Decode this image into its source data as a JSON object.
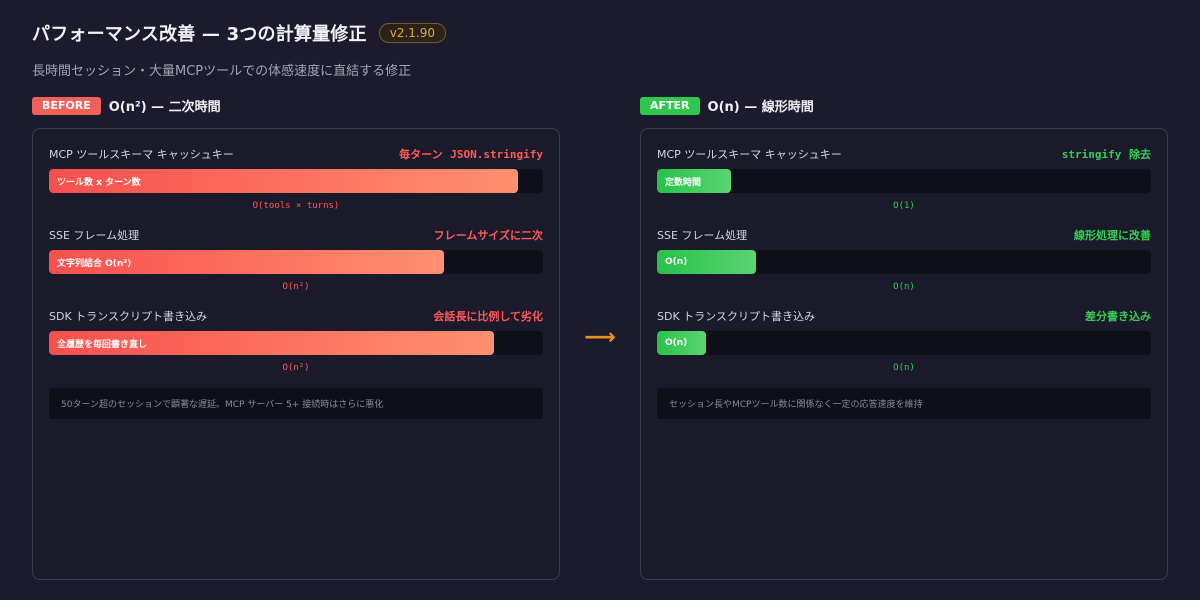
{
  "header": {
    "title": "パフォーマンス改善 — 3つの計算量修正",
    "version": "v2.1.90",
    "subtitle": "長時間セッション・大量MCPツールでの体感速度に直結する修正"
  },
  "colors": {
    "background": "#1c1b2e",
    "before_accent": "#f2605a",
    "after_accent": "#2fc84f",
    "arrow": "#e8901c",
    "version_badge": "#e8a33c"
  },
  "arrow_icon": "right-arrow-icon",
  "before": {
    "tag": "BEFORE",
    "title": "O(n²) — 二次時間",
    "items": [
      {
        "label": "MCP ツールスキーマ キャッシュキー",
        "note_text": "毎ターン",
        "note_code": "JSON.stringify",
        "bar_label": "ツール数 x ターン数",
        "fill": 0.95,
        "complexity": "O(tools × turns)"
      },
      {
        "label": "SSE フレーム処理",
        "note_text": "フレームサイズに二次",
        "bar_label": "文字列結合 O(n²)",
        "fill": 0.8,
        "complexity": "O(n²)"
      },
      {
        "label": "SDK トランスクリプト書き込み",
        "note_text": "会話長に比例して劣化",
        "bar_label": "全履歴を毎回書き直し",
        "fill": 0.9,
        "complexity": "O(n²)"
      }
    ],
    "footnote": "50ターン超のセッションで顕著な遅延。MCP サーバー 5+ 接続時はさらに悪化"
  },
  "after": {
    "tag": "AFTER",
    "title": "O(n) — 線形時間",
    "items": [
      {
        "label": "MCP ツールスキーマ キャッシュキー",
        "note_code": "stringify",
        "note_text": "除去",
        "bar_label": "定数時間",
        "fill": 0.15,
        "complexity": "O(1)"
      },
      {
        "label": "SSE フレーム処理",
        "note_text": "線形処理に改善",
        "bar_label": "O(n)",
        "fill": 0.2,
        "complexity": "O(n)"
      },
      {
        "label": "SDK トランスクリプト書き込み",
        "note_text": "差分書き込み",
        "bar_label": "O(n)",
        "fill": 0.1,
        "complexity": "O(n)"
      }
    ],
    "footnote": "セッション長やMCPツール数に関係なく一定の応答速度を維持"
  }
}
